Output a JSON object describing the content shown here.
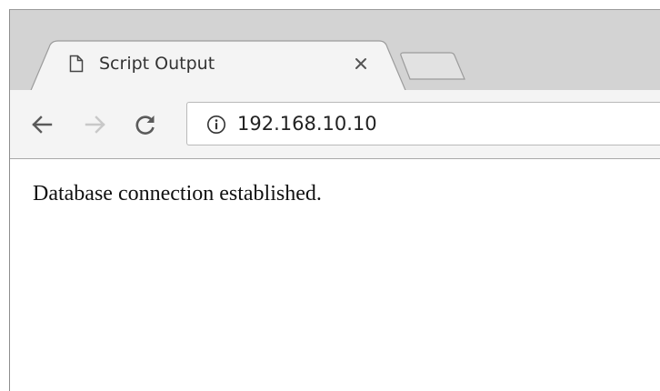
{
  "tab": {
    "title": "Script Output",
    "icon": "page-icon"
  },
  "toolbar": {
    "back_icon": "arrow-left-icon",
    "forward_icon": "arrow-right-icon",
    "reload_icon": "reload-icon",
    "forward_enabled": false
  },
  "address_bar": {
    "url": "192.168.10.10",
    "security_icon": "info-icon"
  },
  "page": {
    "body_text": "Database connection established."
  },
  "colors": {
    "tabstrip": "#d3d3d3",
    "toolbar": "#f4f4f4",
    "icon_active": "#5a5a5a",
    "icon_disabled": "#c8c8c8"
  }
}
